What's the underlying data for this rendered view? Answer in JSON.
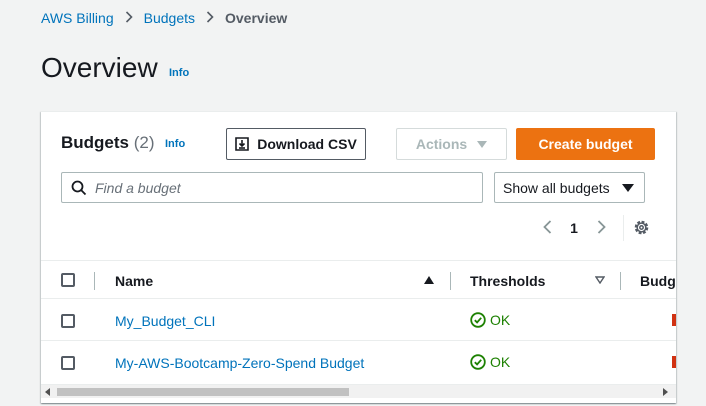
{
  "breadcrumb": {
    "items": [
      "AWS Billing",
      "Budgets"
    ],
    "current": "Overview"
  },
  "page": {
    "title": "Overview",
    "info": "Info"
  },
  "budgets_panel": {
    "title": "Budgets",
    "count": "(2)",
    "info": "Info",
    "download_label": "Download CSV",
    "actions_label": "Actions",
    "create_label": "Create budget",
    "search_placeholder": "Find a budget",
    "filter_selected": "Show all budgets",
    "page_number": "1"
  },
  "table": {
    "columns": [
      "Name",
      "Thresholds",
      "Budget"
    ],
    "rows": [
      {
        "name": "My_Budget_CLI",
        "threshold": "OK"
      },
      {
        "name": "My-AWS-Bootcamp-Zero-Spend Budget",
        "threshold": "OK"
      }
    ]
  },
  "colors": {
    "link": "#0073bb",
    "primary_button": "#ec7211",
    "ok_status": "#1d8102"
  },
  "icons": [
    "chevron-right-icon",
    "download-icon",
    "caret-down-icon",
    "search-icon",
    "chevron-left-icon",
    "gear-icon",
    "sort-ascending-icon",
    "sort-descending-icon",
    "status-ok-icon"
  ]
}
